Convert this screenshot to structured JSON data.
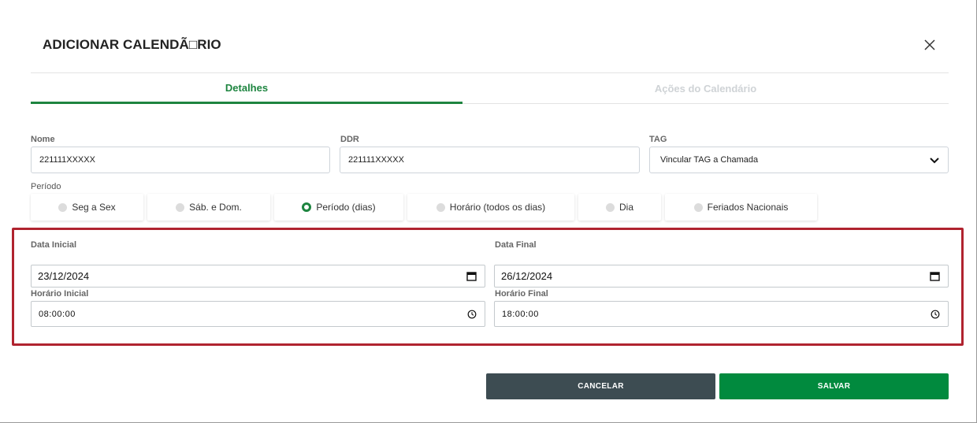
{
  "dialog": {
    "title": "ADICIONAR CALENDÃ□RIO"
  },
  "tabs": [
    {
      "label": "Detalhes",
      "active": true
    },
    {
      "label": "Ações do Calendário",
      "active": false
    }
  ],
  "form": {
    "nome": {
      "label": "Nome",
      "value": "221111XXXXX"
    },
    "ddr": {
      "label": "DDR",
      "value": "221111XXXXX"
    },
    "tag": {
      "label": "TAG",
      "value": "Vincular TAG a Chamada"
    }
  },
  "periodo": {
    "label": "Período",
    "options": [
      {
        "label": "Seg a Sex",
        "checked": false
      },
      {
        "label": "Sáb. e Dom.",
        "checked": false
      },
      {
        "label": "Período (dias)",
        "checked": true
      },
      {
        "label": "Horário (todos os dias)",
        "checked": false
      },
      {
        "label": "Dia",
        "checked": false
      },
      {
        "label": "Feriados Nacionais",
        "checked": false
      }
    ]
  },
  "range": {
    "data_inicial": {
      "label": "Data Inicial",
      "value": "23/12/2024"
    },
    "data_final": {
      "label": "Data Final",
      "value": "26/12/2024"
    },
    "horario_inicial": {
      "label": "Horário Inicial",
      "value": "08:00:00"
    },
    "horario_final": {
      "label": "Horário Final",
      "value": "18:00:00"
    }
  },
  "actions": {
    "cancel_label": "CANCELAR",
    "save_label": "SALVAR"
  },
  "colors": {
    "primary_green": "#1e8540",
    "save_button": "#018a3e",
    "cancel_button": "#3d4c52",
    "highlight_border": "#b0232f"
  },
  "icons": {
    "close": "close-icon",
    "select": "chevron-down-icon",
    "date": "calendar-icon",
    "time": "clock-icon"
  }
}
